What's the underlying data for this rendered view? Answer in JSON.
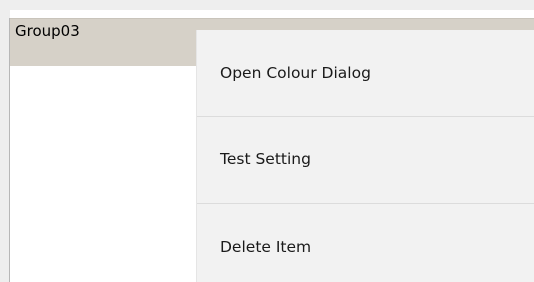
{
  "group": {
    "label": "Group03"
  },
  "context_menu": {
    "items": [
      {
        "label": "Open Colour Dialog"
      },
      {
        "label": "Test Setting"
      },
      {
        "label": "Delete Item"
      }
    ]
  },
  "colors": {
    "group_header_bg": "#d6d1c8",
    "menu_bg": "#f2f2f2",
    "divider": "#dcdcdc"
  }
}
